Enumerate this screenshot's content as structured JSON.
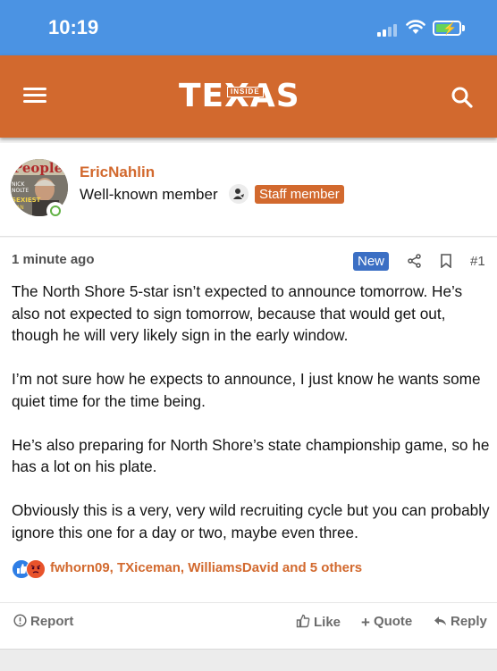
{
  "status_bar": {
    "time": "10:19"
  },
  "header": {
    "logo_main": "TEXAS",
    "logo_badge": "INSIDE"
  },
  "user": {
    "name": "EricNahlin",
    "title": "Well-known member",
    "staff_badge": "Staff member",
    "online": true
  },
  "post": {
    "time_ago": "1 minute ago",
    "new_badge": "New",
    "number": "#1",
    "paragraphs": [
      "The North Shore 5-star isn’t expected to announce tomorrow. He’s also not expected to sign tomorrow, because that would get out, though he will very likely sign in the early window.",
      "I’m not sure how he expects to announce, I just know he wants some quiet time for the time being.",
      "He’s also preparing for North Shore’s state championship game, so he has a lot on his plate.",
      "Obviously this is a very, very wild recruiting cycle but you can probably ignore this one for a day or two, maybe even three."
    ],
    "reactions_text": "fwhorn09, TXiceman, WilliamsDavid and 5 others",
    "actions": {
      "report": "Report",
      "like": "Like",
      "quote": "Quote",
      "reply": "Reply"
    }
  },
  "colors": {
    "status_bar": "#4b93e3",
    "brand_orange": "#d2692e",
    "new_badge": "#3b6fc4"
  }
}
